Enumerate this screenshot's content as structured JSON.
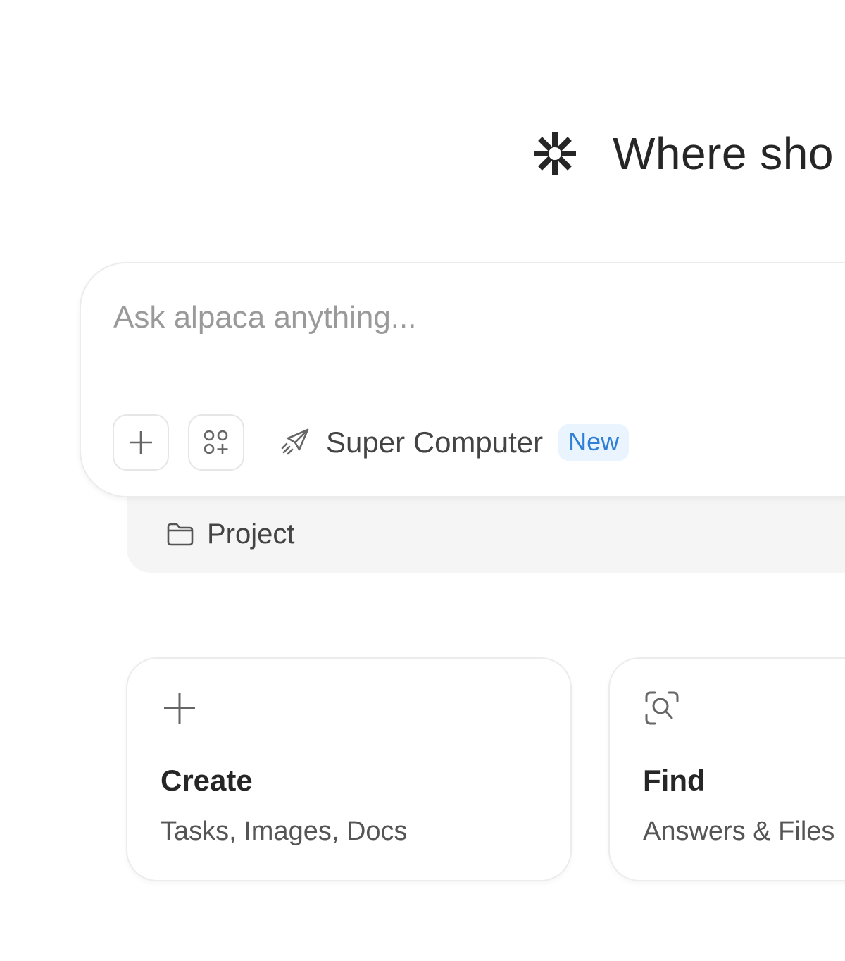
{
  "header": {
    "title": "Where sho",
    "logo_icon": "asterisk-burst-icon"
  },
  "composer": {
    "placeholder": "Ask alpaca anything...",
    "value": "",
    "add_icon": "plus-icon",
    "apps_icon": "apps-grid-plus-icon",
    "mode": {
      "icon": "paper-plane-icon",
      "label": "Super Computer",
      "badge": "New",
      "badge_color": "#2f7fd6",
      "badge_bg": "#eaf4fe"
    }
  },
  "project": {
    "icon": "folder-icon",
    "label": "Project"
  },
  "cards": [
    {
      "icon": "plus-icon",
      "title": "Create",
      "subtitle": "Tasks, Images, Docs"
    },
    {
      "icon": "search-scan-icon",
      "title": "Find",
      "subtitle": "Answers & Files"
    }
  ]
}
